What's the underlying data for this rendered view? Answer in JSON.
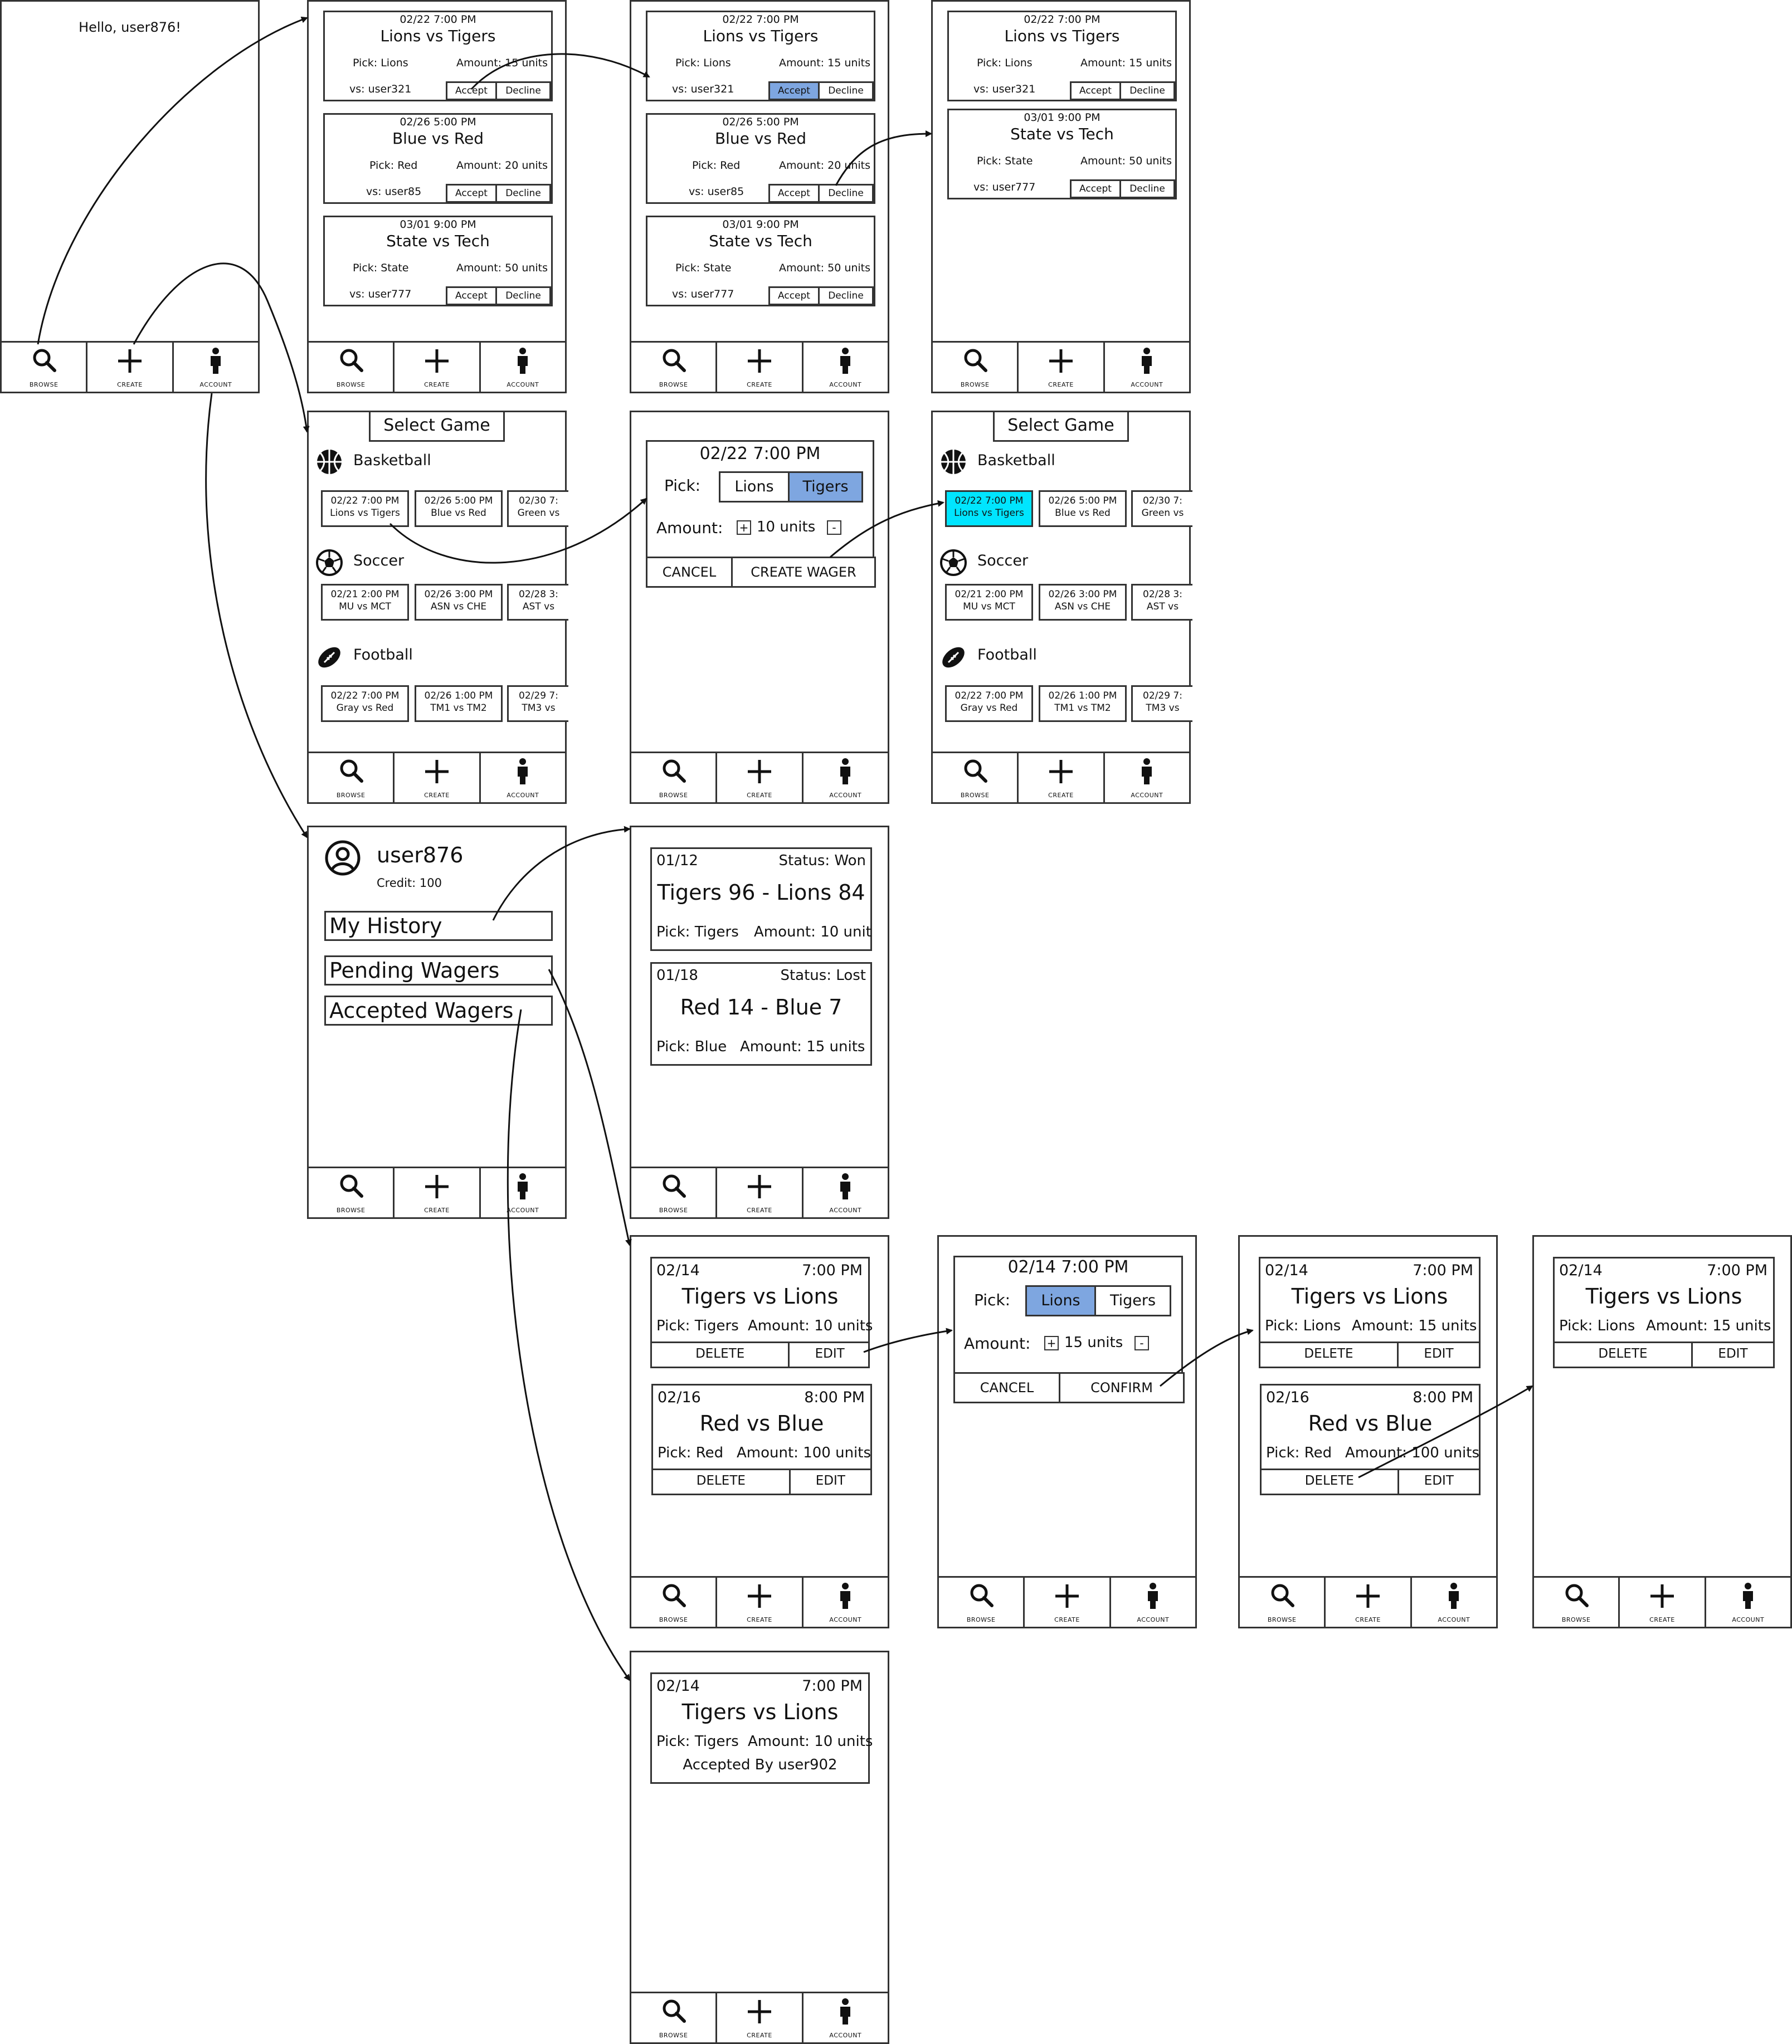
{
  "nav": {
    "browse": "BROWSE",
    "create": "CREATE",
    "account": "ACCOUNT"
  },
  "home": {
    "greeting": "Hello, user876!"
  },
  "wagers": {
    "w1": {
      "date": "02/22 7:00 PM",
      "title": "Lions vs Tigers",
      "pick": "Pick: Lions",
      "amount": "Amount: 15 units",
      "vs": "vs: user321"
    },
    "w2": {
      "date": "02/26 5:00 PM",
      "title": "Blue vs Red",
      "pick": "Pick: Red",
      "amount": "Amount: 20 units",
      "vs": "vs: user85"
    },
    "w3": {
      "date": "03/01 9:00 PM",
      "title": "State vs Tech",
      "pick": "Pick: State",
      "amount": "Amount: 50 units",
      "vs": "vs: user777"
    },
    "accept": "Accept",
    "decline": "Decline"
  },
  "select": {
    "title": "Select Game",
    "basketball": "Basketball",
    "soccer": "Soccer",
    "football": "Football",
    "b1": [
      "02/22 7:00 PM",
      "Lions vs Tigers"
    ],
    "b2": [
      "02/26 5:00 PM",
      "Blue vs Red"
    ],
    "b3": [
      "02/30 7:",
      "Green vs"
    ],
    "s1": [
      "02/21 2:00 PM",
      "MU vs MCT"
    ],
    "s2": [
      "02/26 3:00 PM",
      "ASN vs CHE"
    ],
    "s3": [
      "02/28 3:",
      "AST vs"
    ],
    "f1": [
      "02/22 7:00 PM",
      "Gray vs Red"
    ],
    "f2": [
      "02/26 1:00 PM",
      "TM1 vs TM2"
    ],
    "f3": [
      "02/29 7:",
      "TM3 vs"
    ]
  },
  "create": {
    "date": "02/22 7:00 PM",
    "pick_label": "Pick:",
    "opt1": "Lions",
    "opt2": "Tigers",
    "amount_label": "Amount:",
    "plus": "+",
    "minus": "-",
    "units": "10 units",
    "cancel": "CANCEL",
    "submit": "CREATE WAGER"
  },
  "account": {
    "username": "user876",
    "credit": "Credit: 100",
    "history": "My History",
    "pending": "Pending Wagers",
    "accepted": "Accepted Wagers"
  },
  "history": {
    "h1": {
      "date": "01/12",
      "status": "Status: Won",
      "score": "Tigers 96 - Lions 84",
      "pick": "Pick: Tigers",
      "amount": "Amount: 10 unit"
    },
    "h2": {
      "date": "01/18",
      "status": "Status: Lost",
      "score": "Red 14 - Blue 7",
      "pick": "Pick: Blue",
      "amount": "Amount: 15 units"
    }
  },
  "pending": {
    "p1": {
      "date": "02/14",
      "time": "7:00 PM",
      "title": "Tigers vs Lions",
      "pick": "Pick: Tigers",
      "amount": "Amount: 10 units"
    },
    "p2": {
      "date": "02/16",
      "time": "8:00 PM",
      "title": "Red vs Blue",
      "pick": "Pick: Red",
      "amount": "Amount: 100 units"
    },
    "p1e": {
      "pick": "Pick: Lions",
      "amount": "Amount: 15 units"
    },
    "delete": "DELETE",
    "edit": "EDIT"
  },
  "edit": {
    "date": "02/14 7:00 PM",
    "pick_label": "Pick:",
    "opt1": "Lions",
    "opt2": "Tigers",
    "amount_label": "Amount:",
    "plus": "+",
    "minus": "-",
    "units": "15 units",
    "cancel": "CANCEL",
    "confirm": "CONFIRM"
  },
  "accepted": {
    "date": "02/14",
    "time": "7:00 PM",
    "title": "Tigers vs Lions",
    "pick": "Pick: Tigers",
    "amount": "Amount: 10 units",
    "by": "Accepted By user902"
  }
}
